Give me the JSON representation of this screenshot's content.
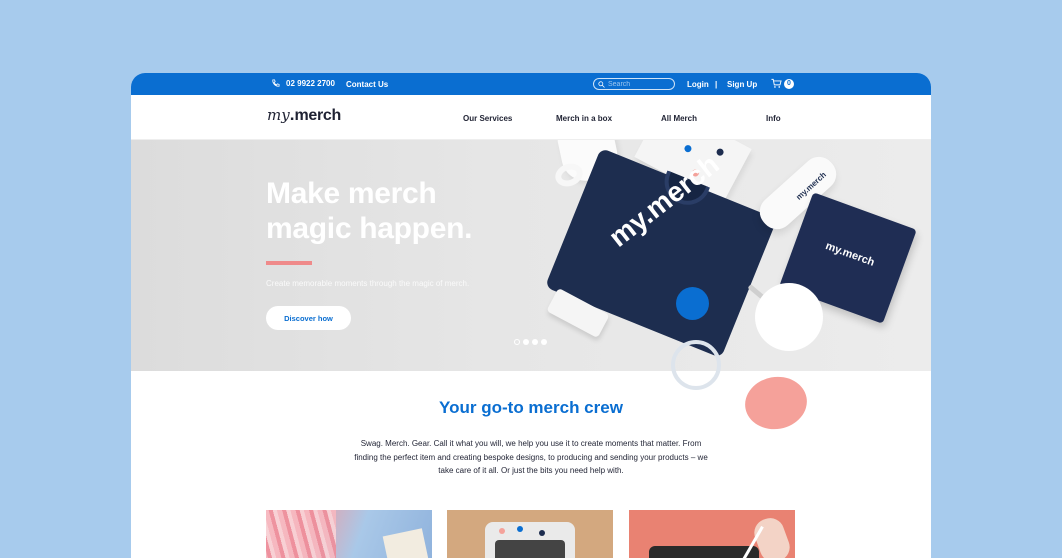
{
  "topbar": {
    "phone": "02 9922 2700",
    "contact_label": "Contact Us",
    "search_placeholder": "Search",
    "login_label": "Login",
    "separator": "|",
    "signup_label": "Sign Up",
    "cart_count": "0"
  },
  "nav": {
    "logo_my": "my",
    "logo_dot": ".",
    "logo_merch": "merch",
    "items": [
      {
        "label": "Our Services"
      },
      {
        "label": "Merch in a box"
      },
      {
        "label": "All Merch"
      },
      {
        "label": "Info"
      }
    ]
  },
  "hero": {
    "title_line1": "Make merch",
    "title_line2": "magic happen.",
    "subtitle": "Create memorable moments through the magic of merch.",
    "cta_label": "Discover how",
    "product_text_shirt": "my.merch",
    "product_text_notebook": "my.merch",
    "product_text_bottle": "my.merch",
    "carousel_active_index": 1,
    "carousel_count": 4
  },
  "intro": {
    "heading": "Your go-to merch crew",
    "body": "Swag. Merch. Gear. Call it what you will, we help you use it to create moments that matter. From finding the perfect item and creating bespoke designs, to producing and sending your products – we take care of it all. Or just the bits you need help with."
  },
  "colors": {
    "brand_blue": "#0a6ed1",
    "accent_pink": "#ef8a8a",
    "background": "#a7cbed"
  }
}
